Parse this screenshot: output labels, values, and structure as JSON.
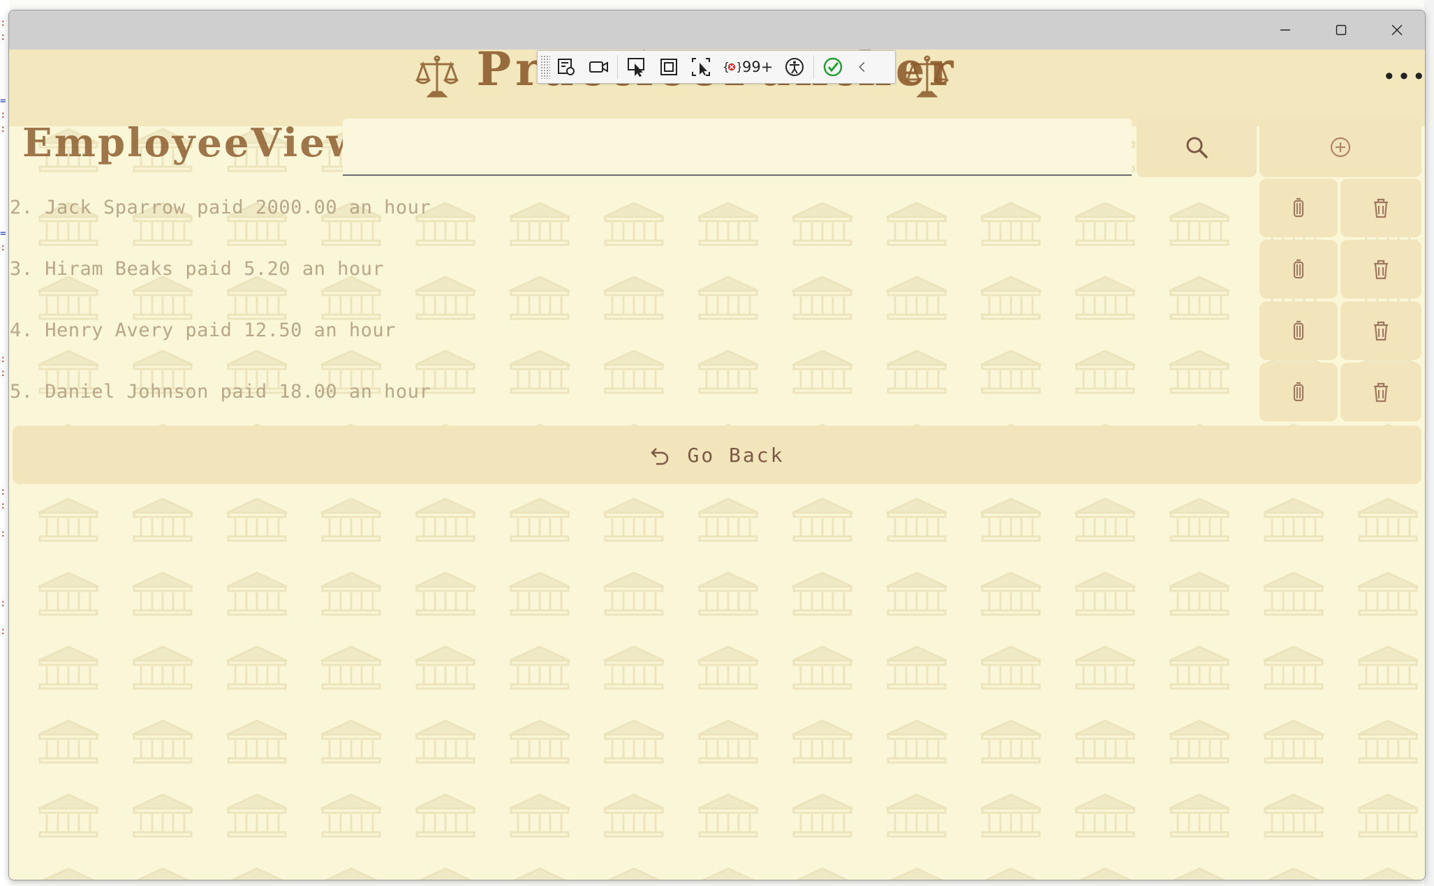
{
  "app": {
    "title": "PracticePanther",
    "more_label": "•••"
  },
  "debug_toolbar": {
    "error_count": "99+"
  },
  "page": {
    "heading": "EmployeeView"
  },
  "search": {
    "value": "",
    "placeholder": ""
  },
  "employees": [
    {
      "text": "2. Jack Sparrow paid 2000.00 an hour"
    },
    {
      "text": "3. Hiram Beaks paid 5.20 an hour"
    },
    {
      "text": "4. Henry Avery paid 12.50 an hour"
    },
    {
      "text": "5. Daniel Johnson paid 18.00 an hour"
    }
  ],
  "go_back": {
    "label": "Go Back"
  },
  "icons": {
    "window_controls": [
      "minimize-icon",
      "maximize-icon",
      "close-icon"
    ],
    "row_actions": [
      "lantern-icon",
      "trash-icon"
    ],
    "search": "search-icon",
    "add": "add-circle-icon",
    "back": "undo-arrow-icon",
    "logo": "scales-of-justice-icon",
    "background": "courthouse-icon"
  },
  "colors": {
    "title": "#8b5a2b",
    "header_band": "#f3e8bd",
    "page_background": "#faf6d8",
    "tile": "#f3e5bb",
    "row_text": "#b9a789",
    "status_ok": "#22a033",
    "status_error": "#d32f2f"
  }
}
